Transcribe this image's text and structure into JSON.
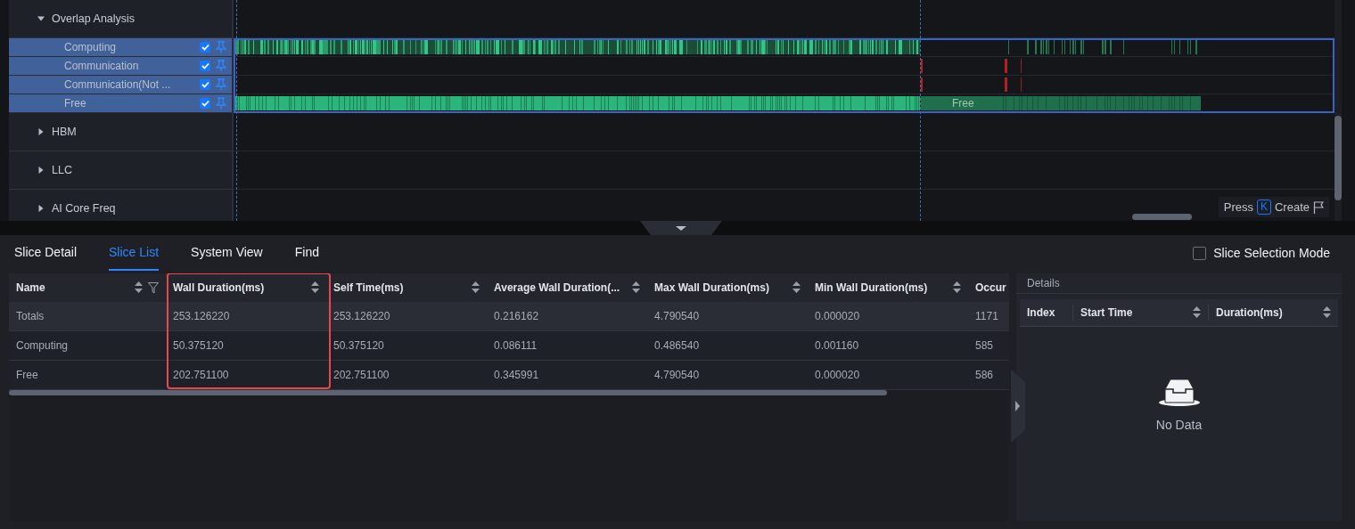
{
  "timeline": {
    "tracks": [
      {
        "label": "Overlap Analysis",
        "expanded": true,
        "children": [
          {
            "label": "Computing",
            "selected": true,
            "checked": true
          },
          {
            "label": "Communication",
            "selected": true,
            "checked": true
          },
          {
            "label": "Communication(Not ...",
            "selected": true,
            "checked": true
          },
          {
            "label": "Free",
            "selected": true,
            "checked": true
          }
        ]
      },
      {
        "label": "HBM",
        "expanded": false
      },
      {
        "label": "LLC",
        "expanded": false
      },
      {
        "label": "AI Core Freq",
        "expanded": false
      }
    ],
    "slice_label": "Free",
    "hint": {
      "prefix": "Press",
      "key": "K",
      "action": "Create"
    }
  },
  "tabs": [
    {
      "label": "Slice Detail",
      "selected": false
    },
    {
      "label": "Slice List",
      "selected": true
    },
    {
      "label": "System View",
      "selected": false
    },
    {
      "label": "Find",
      "selected": false
    }
  ],
  "slice_selection_mode": {
    "label": "Slice Selection Mode",
    "checked": false
  },
  "slice_table": {
    "columns": [
      {
        "label": "Name",
        "sortable": true,
        "filterable": true
      },
      {
        "label": "Wall Duration(ms)",
        "sortable": true,
        "highlighted": true
      },
      {
        "label": "Self Time(ms)",
        "sortable": true
      },
      {
        "label": "Average Wall Duration(...",
        "sortable": true
      },
      {
        "label": "Max Wall Duration(ms)",
        "sortable": true
      },
      {
        "label": "Min Wall Duration(ms)",
        "sortable": true
      },
      {
        "label": "Occur",
        "sortable": false
      }
    ],
    "rows": [
      [
        "Totals",
        "253.126220",
        "253.126220",
        "0.216162",
        "4.790540",
        "0.000020",
        "1171"
      ],
      [
        "Computing",
        "50.375120",
        "50.375120",
        "0.086111",
        "0.486540",
        "0.001160",
        "585"
      ],
      [
        "Free",
        "202.751100",
        "202.751100",
        "0.345991",
        "4.790540",
        "0.000020",
        "586"
      ]
    ]
  },
  "details": {
    "title": "Details",
    "columns": [
      {
        "label": "Index",
        "sortable": false
      },
      {
        "label": "Start Time",
        "sortable": true
      },
      {
        "label": "Duration(ms)",
        "sortable": true
      }
    ],
    "empty_text": "No Data"
  }
}
